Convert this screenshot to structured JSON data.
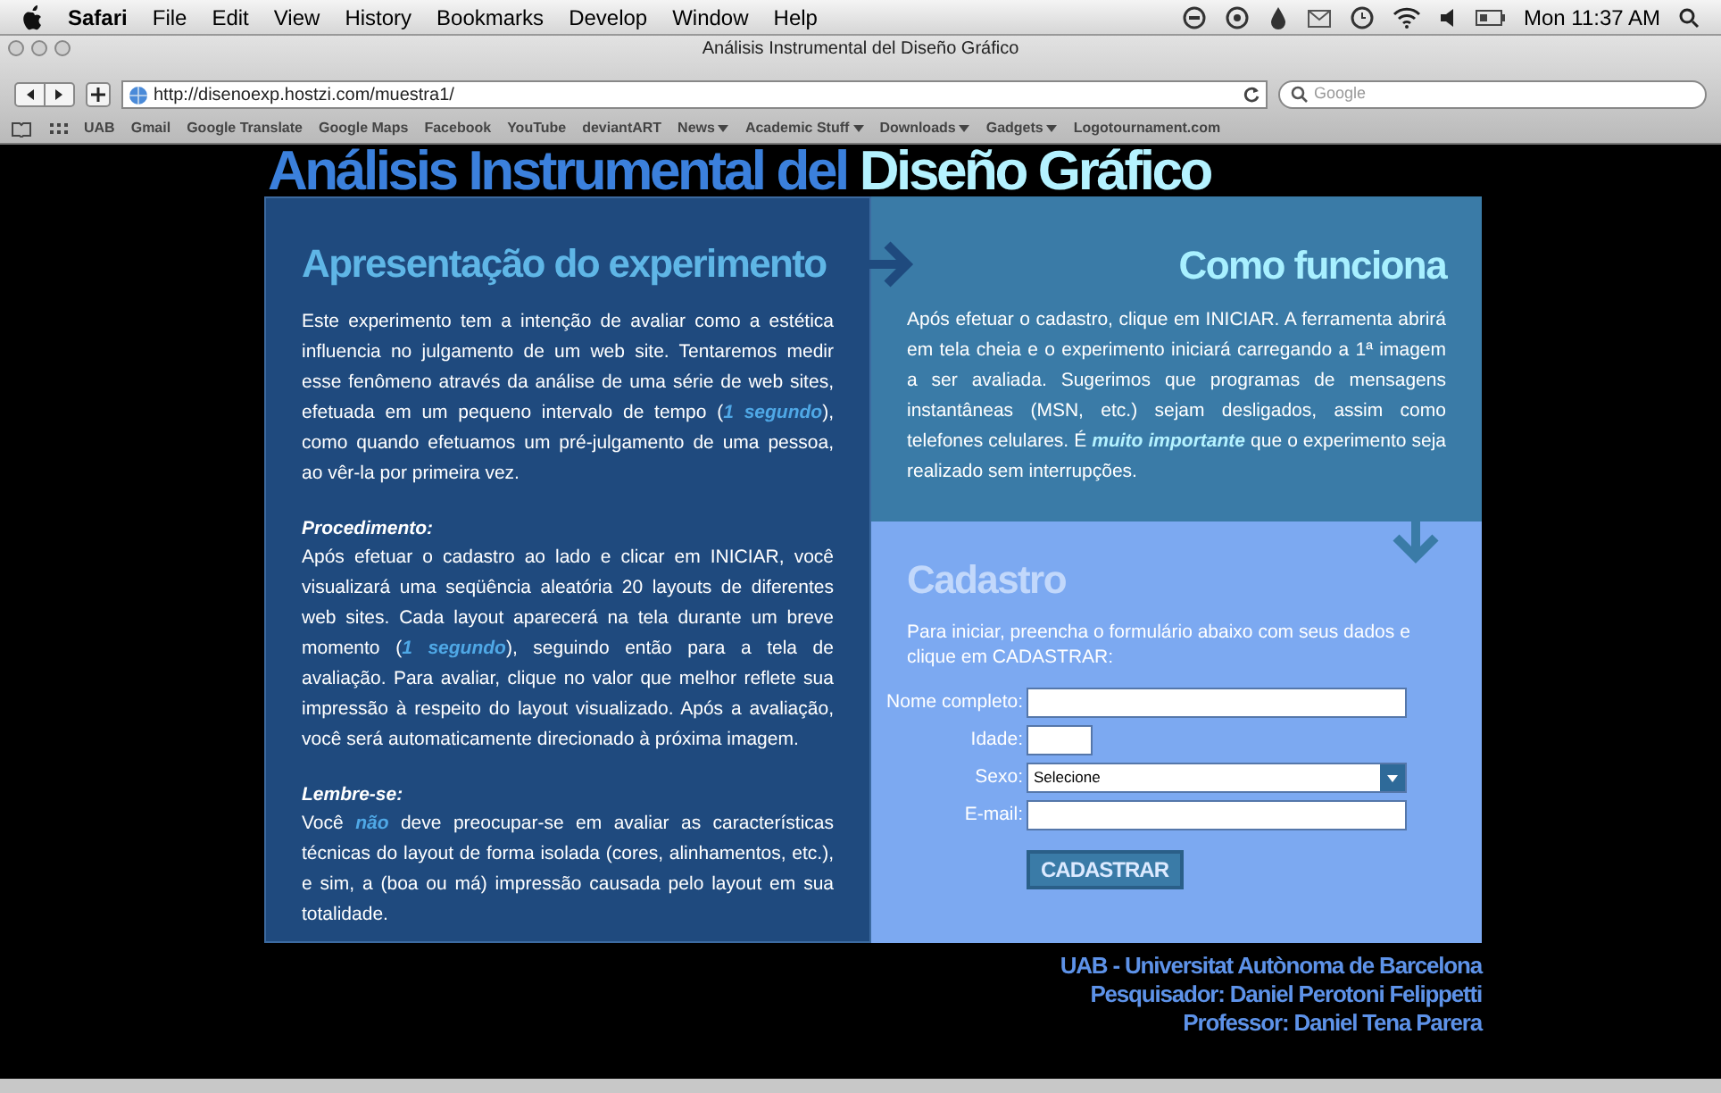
{
  "menu_bar": {
    "app": "Safari",
    "items": [
      "File",
      "Edit",
      "View",
      "History",
      "Bookmarks",
      "Develop",
      "Window",
      "Help"
    ],
    "clock": "Mon 11:37 AM"
  },
  "window": {
    "title": "Análisis Instrumental del Diseño Gráfico"
  },
  "toolbar": {
    "url": "http://disenoexp.hostzi.com/muestra1/",
    "search_placeholder": "Google"
  },
  "bookmarks": [
    {
      "label": "UAB",
      "menu": false
    },
    {
      "label": "Gmail",
      "menu": false
    },
    {
      "label": "Google Translate",
      "menu": false
    },
    {
      "label": "Google Maps",
      "menu": false
    },
    {
      "label": "Facebook",
      "menu": false
    },
    {
      "label": "YouTube",
      "menu": false
    },
    {
      "label": "deviantART",
      "menu": false
    },
    {
      "label": "News",
      "menu": true
    },
    {
      "label": "Academic Stuff",
      "menu": true
    },
    {
      "label": "Downloads",
      "menu": true
    },
    {
      "label": "Gadgets",
      "menu": true
    },
    {
      "label": "Logotournament.com",
      "menu": false
    }
  ],
  "page": {
    "title_parts": [
      {
        "text": "Análisis Instrumental del ",
        "kind": "main"
      },
      {
        "text": "Diseño Gráfico",
        "kind": "accent"
      }
    ],
    "presentation": {
      "heading": "Apresentação do experimento",
      "paragraphs": [
        {
          "text": "Este experimento tem a intenção de avaliar como a estética influencia no julgamento de um web site. Tentaremos medir esse fenômeno através da análise de uma série de web sites, efetuada em um pequeno intervalo de tempo (*1 segundo*), como quando efetuamos um pré-julgamento de uma pessoa, ao vêr-la por primeira vez."
        },
        {
          "subheading": "Procedimento:",
          "text": "Após efetuar o cadastro ao lado e clicar em INICIAR, você visualizará uma seqüência aleatória 20 layouts de diferentes web sites. Cada layout aparecerá na tela durante um breve momento (*1 segundo*), seguindo então para a tela de avaliação. Para avaliar, clique no valor que melhor reflete sua impressão à respeito do layout visualizado. Após a avaliação, você será automaticamente direcionado à próxima imagem."
        },
        {
          "subheading": "Lembre-se:",
          "text": "Você *não* deve preocupar-se em avaliar as características técnicas do layout de forma isolada (cores, alinhamentos, etc.), e sim, a (boa ou má) impressão causada pelo layout em sua totalidade."
        }
      ]
    },
    "how_it_works": {
      "heading": "Como funciona",
      "text": "Após efetuar o cadastro, clique em INICIAR. A ferramenta abrirá em tela cheia e o experimento iniciará carregando a 1ª imagem a ser avaliada. Sugerimos que programas de mensagens instantâneas (MSN, etc.) sejam desligados, assim como telefones celulares. É *muito importante* que o experimento seja realizado sem interrupções."
    },
    "registration": {
      "heading": "Cadastro",
      "intro": "Para iniciar, preencha o formulário abaixo com seus dados e clique em CADASTRAR:",
      "fields": [
        {
          "label": "Nome completo:",
          "kind": "text"
        },
        {
          "label": "Idade:",
          "kind": "short"
        },
        {
          "label": "Sexo:",
          "kind": "select",
          "value": "Selecione"
        },
        {
          "label": "E-mail:",
          "kind": "text"
        }
      ],
      "button": "CADASTRAR"
    },
    "credits": [
      "UAB - Universitat Autònoma de Barcelona",
      "Pesquisador: Daniel Perotoni Felippetti",
      "Professor: Daniel Tena Parera"
    ]
  }
}
